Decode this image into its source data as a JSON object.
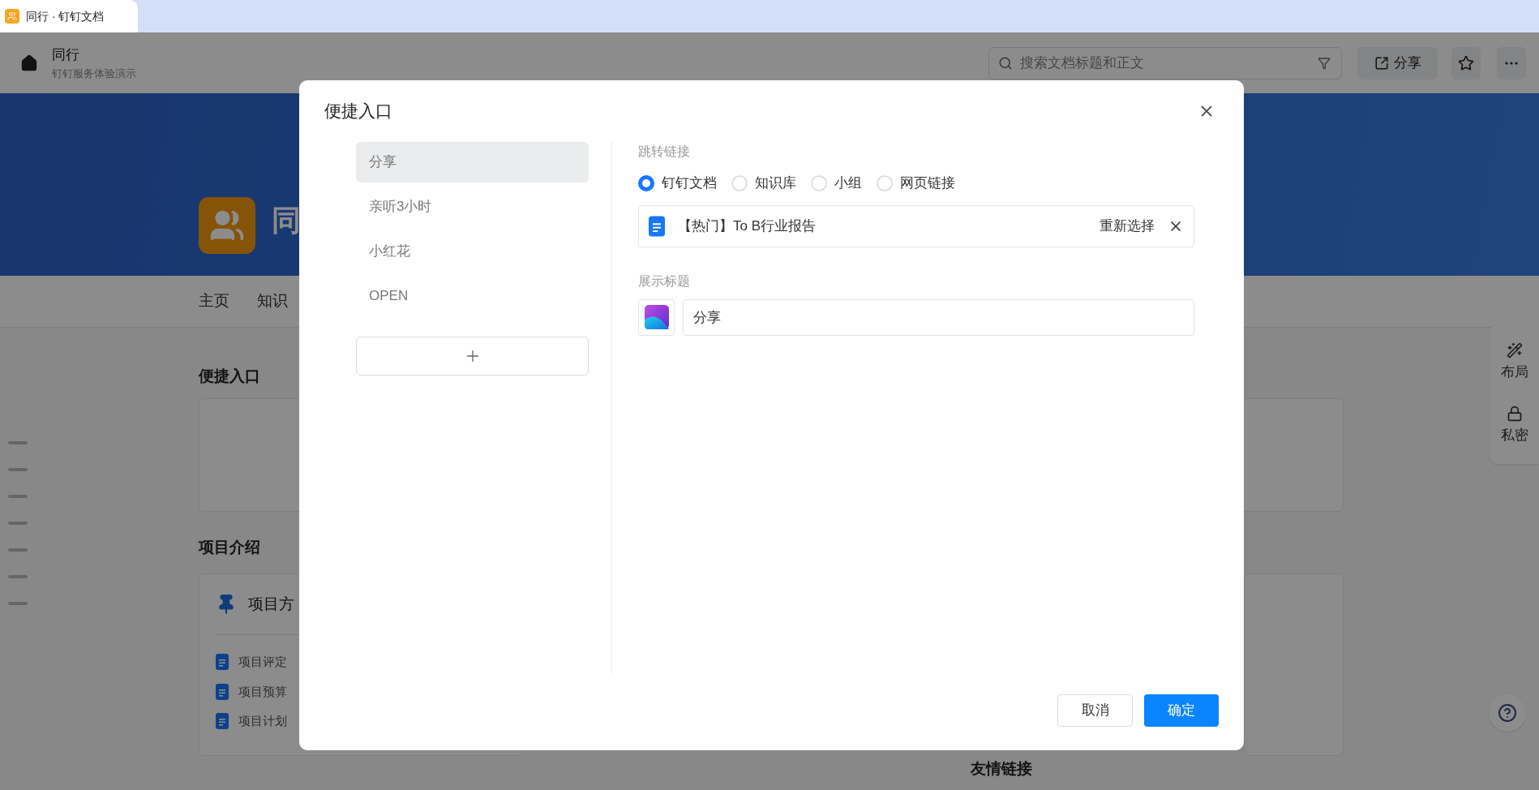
{
  "browser_tab": {
    "title": "同行 · 钉钉文档"
  },
  "header": {
    "title": "同行",
    "subtitle": "钉钉服务体验演示",
    "search": {
      "placeholder": "搜索文档标题和正文"
    },
    "share_button": "分享"
  },
  "banner": {
    "title": "同"
  },
  "nav": [
    "主页",
    "知识"
  ],
  "sections": {
    "shortcuts": {
      "title": "便捷入口"
    },
    "intro": {
      "title": "项目介绍",
      "card_title": "项目方",
      "docs": [
        "项目评定",
        "项目预算",
        "项目计划"
      ]
    },
    "links": {
      "title": "友情链接"
    }
  },
  "side_toolbar": [
    {
      "label": "布局",
      "kind": "wand"
    },
    {
      "label": "私密",
      "kind": "lock"
    }
  ],
  "dialog": {
    "title": "便捷入口",
    "entries": [
      {
        "label": "分享",
        "selected": true
      },
      {
        "label": "亲听3小时",
        "selected": false
      },
      {
        "label": "小红花",
        "selected": false
      },
      {
        "label": "OPEN",
        "selected": false
      }
    ],
    "link_label": "跳转链接",
    "link_types": [
      {
        "label": "钉钉文档",
        "selected": true
      },
      {
        "label": "知识库",
        "selected": false
      },
      {
        "label": "小组",
        "selected": false
      },
      {
        "label": "网页链接",
        "selected": false
      }
    ],
    "linked_doc": {
      "title": "【热门】To B行业报告",
      "reselect": "重新选择"
    },
    "display_label": "展示标题",
    "display_value": "分享",
    "cancel_button": "取消",
    "ok_button": "确定"
  }
}
